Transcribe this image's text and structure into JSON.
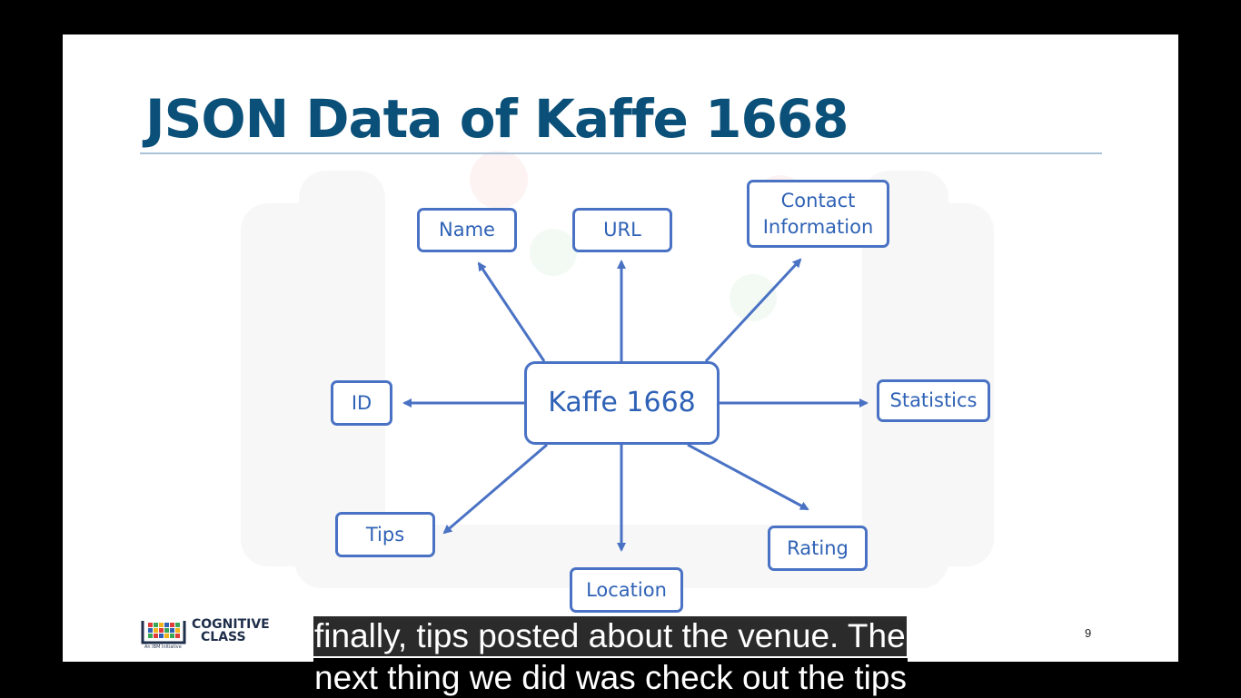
{
  "slide": {
    "title": "JSON Data of Kaffe 1668",
    "page_number": "9"
  },
  "diagram": {
    "center": "Kaffe 1668",
    "nodes": {
      "name": "Name",
      "url": "URL",
      "contact": "Contact\nInformation",
      "id": "ID",
      "statistics": "Statistics",
      "tips": "Tips",
      "location": "Location",
      "rating": "Rating"
    },
    "stroke_color": "#4a72c4",
    "text_color": "#2f62b6"
  },
  "logo": {
    "line1": "COGNITIVE",
    "line2": "CLASS",
    "tagline": "An IBM Initiative"
  },
  "captions": {
    "line1": "finally, tips posted about the venue. The",
    "line2": "next thing we did was check out the tips"
  },
  "colors": {
    "title": "#0b5079",
    "slide_bg": "#ffffff",
    "frame_bg": "#000000"
  }
}
